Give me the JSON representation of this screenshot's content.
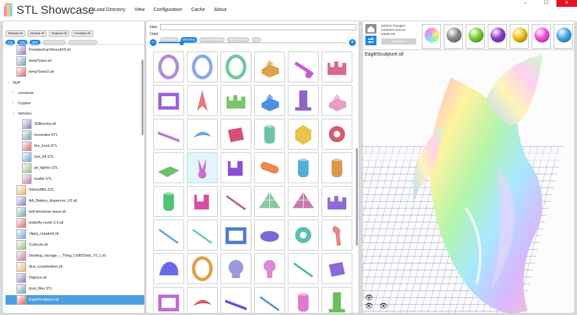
{
  "app": {
    "title": "STL Showcase"
  },
  "menu": [
    "Load Directory",
    "View",
    "Configuration",
    "Cache",
    "About"
  ],
  "window_controls": {
    "minimize": "–",
    "maximize": "☐",
    "close": "✕"
  },
  "toolbar": {
    "buttons": [
      "Reload All",
      "Unload All",
      "Expand All",
      "Contract All"
    ],
    "filters": [
      {
        "label": "STL",
        "on": true
      },
      {
        "label": "OBJ",
        "on": true
      },
      {
        "label": "3MF",
        "on": true
      },
      {
        "label": "Show Folders",
        "on": false
      },
      {
        "label": "Collapsed Folders",
        "on": false
      }
    ]
  },
  "tree": [
    {
      "label": "PredatorFanShroudV6.stl",
      "kind": "file",
      "indent": 2
    },
    {
      "label": "tempTower.stl",
      "kind": "file",
      "indent": 2
    },
    {
      "label": "tempTower2.stl",
      "kind": "file",
      "indent": 2
    },
    {
      "label": "Stuff",
      "kind": "folder-open",
      "indent": 0
    },
    {
      "label": "crossbow",
      "kind": "folder-closed",
      "indent": 1
    },
    {
      "label": "Cryptex",
      "kind": "folder-closed",
      "indent": 1
    },
    {
      "label": "Vehicles",
      "kind": "folder-open",
      "indent": 1
    },
    {
      "label": "3DBenchy.stl",
      "kind": "file",
      "indent": 3
    },
    {
      "label": "excavator.STL",
      "kind": "file",
      "indent": 3
    },
    {
      "label": "fire_truck.STL",
      "kind": "file",
      "indent": 3
    },
    {
      "label": "fork_lift.STL",
      "kind": "file",
      "indent": 3
    },
    {
      "label": "jet_fighter.STL",
      "kind": "file",
      "indent": 3
    },
    {
      "label": "loader.STL",
      "kind": "file",
      "indent": 3
    },
    {
      "label": "04mmABS.STL",
      "kind": "file",
      "indent": 2
    },
    {
      "label": "AA_Battery_dispencer_V2.stl",
      "kind": "file",
      "indent": 2
    },
    {
      "label": "belt-tensioner-wave.stl",
      "kind": "file",
      "indent": 2
    },
    {
      "label": "butterfly-comb-2.0.stl",
      "kind": "file",
      "indent": 2
    },
    {
      "label": "clippy_repaired.stl",
      "kind": "file",
      "indent": 2
    },
    {
      "label": "Cubiculo.stl",
      "kind": "file",
      "indent": 2
    },
    {
      "label": "Desktop_storage_-_Thing_USBSDetc_V1.1.stl",
      "kind": "file",
      "indent": 2
    },
    {
      "label": "dice_icosahedron.stl",
      "kind": "file",
      "indent": 2
    },
    {
      "label": "Digivice.stl",
      "kind": "file",
      "indent": 2
    },
    {
      "label": "dust_filter.STL",
      "kind": "file",
      "indent": 2
    },
    {
      "label": "EagleSculpture.stl",
      "kind": "file",
      "indent": 2,
      "selected": true
    }
  ],
  "grid_panel": {
    "filter_label": "Filter",
    "filter_value": "",
    "order_label": "Order",
    "order_options": [
      {
        "label": "File Name",
        "on": false
      },
      {
        "label": "Directory",
        "on": true
      },
      {
        "label": "Vertex Number",
        "on": false
      },
      {
        "label": "Vertex Count",
        "on": false
      },
      {
        "label": "Size",
        "on": false
      }
    ],
    "zoom": {
      "minus": "−",
      "plus": "+",
      "level": 0.12
    }
  },
  "viewer": {
    "stats": {
      "triangles": "833942 Triangles",
      "vertices": "2463826 Vertices",
      "size": "40685 KB"
    },
    "deselect_label": "Deselect",
    "file_name": "EagleSculpture.stl",
    "materials": [
      {
        "name": "rainbow",
        "color": "#ff8fb0"
      },
      {
        "name": "gray",
        "color": "#8a8a8a"
      },
      {
        "name": "green",
        "color": "#6fd22b"
      },
      {
        "name": "purple",
        "color": "#8a3bd6"
      },
      {
        "name": "yellow",
        "color": "#f0c20a"
      },
      {
        "name": "magenta",
        "color": "#f04ad6"
      },
      {
        "name": "blue",
        "color": "#3aa6ef"
      }
    ]
  },
  "colors": {
    "accent": "#1e88e5",
    "selection": "#4d9ee0"
  }
}
